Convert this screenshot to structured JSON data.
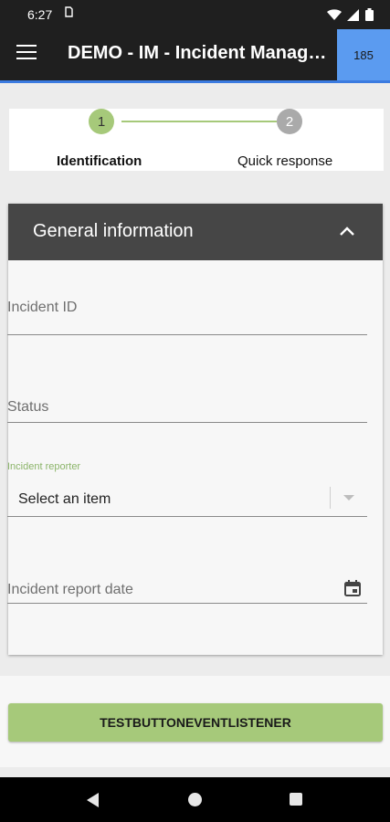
{
  "status_bar": {
    "time": "6:27",
    "icons": [
      "sim-icon",
      "wifi-icon",
      "signal-icon",
      "battery-icon"
    ]
  },
  "app_bar": {
    "title": "DEMO - IM - Incident Management",
    "badge": "185",
    "menu_icon": "menu-icon",
    "bar_color": "#1f1f1f",
    "badge_color": "#5b9bf0",
    "accent_color": "#3b7be0"
  },
  "stepper": {
    "steps": [
      {
        "number": "1",
        "label": "Identification",
        "active": true
      },
      {
        "number": "2",
        "label": "Quick response",
        "active": false
      }
    ],
    "active_color": "#a6c97a",
    "inactive_color": "#aaaaaa"
  },
  "panel": {
    "title": "General information",
    "collapse_icon": "chevron-up-icon",
    "fields": {
      "incident_id": {
        "label": "Incident ID",
        "value": ""
      },
      "status": {
        "label": "Status",
        "value": ""
      },
      "incident_reporter": {
        "label": "Incident reporter",
        "placeholder": "Select an item"
      },
      "incident_report_date": {
        "label": "Incident report date",
        "icon": "calendar-icon"
      }
    }
  },
  "actions": {
    "test_button_label": "TESTBUTTONEVENTLISTENER",
    "button_color": "#a6c97a"
  },
  "nav_bar": {
    "icons": [
      "back-icon",
      "home-icon",
      "recents-icon"
    ]
  }
}
